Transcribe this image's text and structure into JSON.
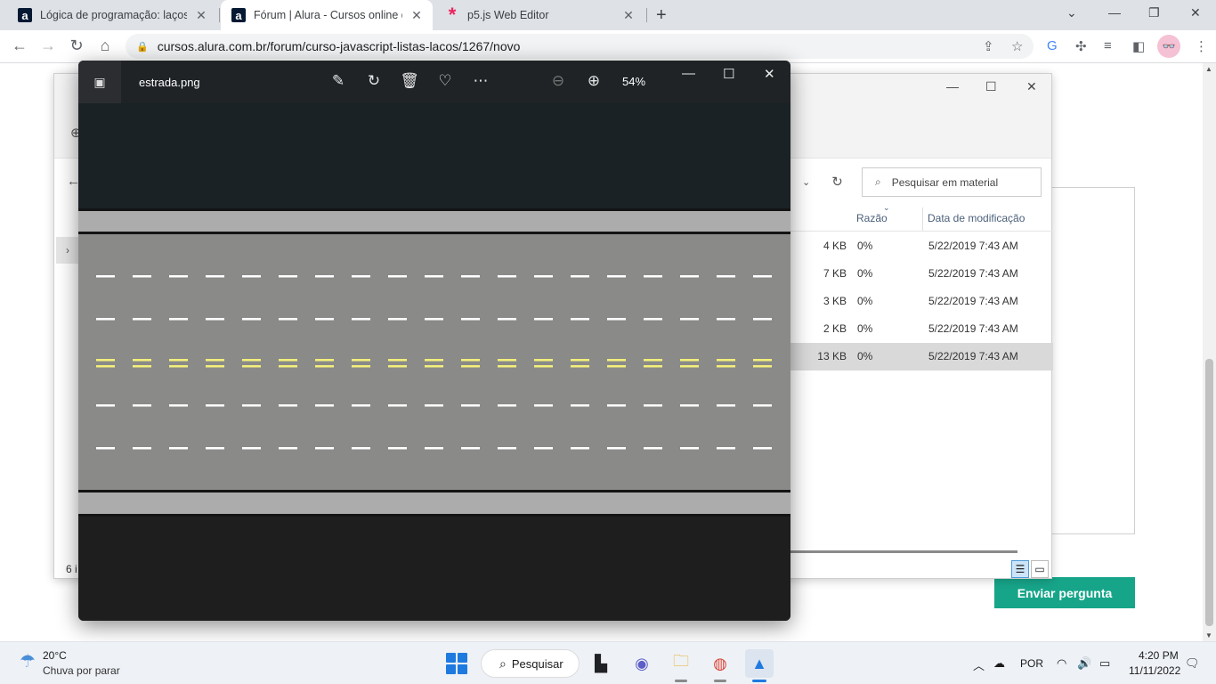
{
  "browser": {
    "tabs": [
      {
        "title": "Lógica de programação: laços e l",
        "favicon": "a"
      },
      {
        "title": "Fórum | Alura - Cursos online de",
        "favicon": "a"
      },
      {
        "title": "p5.js Web Editor",
        "favicon": "*"
      }
    ],
    "close_glyph": "✕",
    "new_tab": "+",
    "url": "cursos.alura.com.br/forum/curso-javascript-listas-lacos/1267/novo"
  },
  "page": {
    "submit_label": "Enviar pergunta",
    "accent_color": "#17a589"
  },
  "explorer": {
    "search_placeholder": "Pesquisar em material",
    "columns": {
      "ratio": "Razão",
      "date": "Data de modificação"
    },
    "rows": [
      {
        "size": "4 KB",
        "ratio": "0%",
        "date": "5/22/2019 7:43 AM"
      },
      {
        "size": "7 KB",
        "ratio": "0%",
        "date": "5/22/2019 7:43 AM"
      },
      {
        "size": "3 KB",
        "ratio": "0%",
        "date": "5/22/2019 7:43 AM"
      },
      {
        "size": "2 KB",
        "ratio": "0%",
        "date": "5/22/2019 7:43 AM"
      },
      {
        "size": "13 KB",
        "ratio": "0%",
        "date": "5/22/2019 7:43 AM"
      }
    ],
    "item_count": "6 i"
  },
  "viewer": {
    "filename": "estrada.png",
    "zoom": "54%",
    "lane_colors": {
      "white": "#ffffff",
      "yellow": "#f3ef7a"
    }
  },
  "taskbar": {
    "weather_temp": "20°C",
    "weather_desc": "Chuva por parar",
    "search_label": "Pesquisar",
    "language": "POR",
    "time": "4:20 PM",
    "date": "11/11/2022"
  }
}
